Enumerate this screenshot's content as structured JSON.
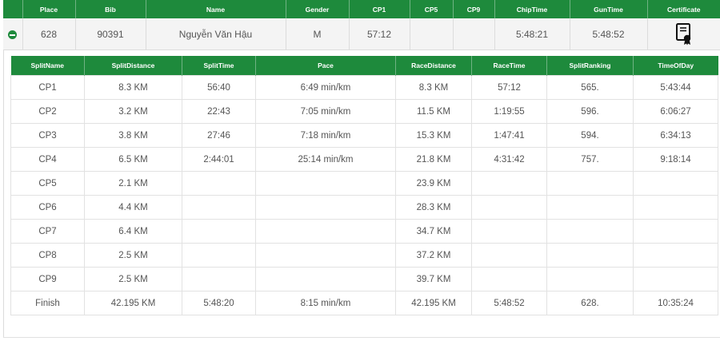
{
  "main": {
    "headers": [
      "Place",
      "Bib",
      "Name",
      "Gender",
      "CP1",
      "CP5",
      "CP9",
      "ChipTime",
      "GunTime",
      "Certificate"
    ],
    "row": {
      "place": "628",
      "bib": "90391",
      "name": "Nguyễn Văn Hậu",
      "gender": "M",
      "cp1": "57:12",
      "cp5": "",
      "cp9": "",
      "chip_time": "5:48:21",
      "gun_time": "5:48:52",
      "certificate_icon": "certificate-icon",
      "toggle_icon": "minus-circle-icon"
    }
  },
  "splits": {
    "headers": [
      "SplitName",
      "SplitDistance",
      "SplitTime",
      "Pace",
      "RaceDistance",
      "RaceTime",
      "SplitRanking",
      "TimeOfDay"
    ],
    "rows": [
      [
        "CP1",
        "8.3 KM",
        "56:40",
        "6:49 min/km",
        "8.3 KM",
        "57:12",
        "565.",
        "5:43:44"
      ],
      [
        "CP2",
        "3.2 KM",
        "22:43",
        "7:05 min/km",
        "11.5 KM",
        "1:19:55",
        "596.",
        "6:06:27"
      ],
      [
        "CP3",
        "3.8 KM",
        "27:46",
        "7:18 min/km",
        "15.3 KM",
        "1:47:41",
        "594.",
        "6:34:13"
      ],
      [
        "CP4",
        "6.5 KM",
        "2:44:01",
        "25:14 min/km",
        "21.8 KM",
        "4:31:42",
        "757.",
        "9:18:14"
      ],
      [
        "CP5",
        "2.1 KM",
        "",
        "",
        "23.9 KM",
        "",
        "",
        ""
      ],
      [
        "CP6",
        "4.4 KM",
        "",
        "",
        "28.3 KM",
        "",
        "",
        ""
      ],
      [
        "CP7",
        "6.4 KM",
        "",
        "",
        "34.7 KM",
        "",
        "",
        ""
      ],
      [
        "CP8",
        "2.5 KM",
        "",
        "",
        "37.2 KM",
        "",
        "",
        ""
      ],
      [
        "CP9",
        "2.5 KM",
        "",
        "",
        "39.7 KM",
        "",
        "",
        ""
      ],
      [
        "Finish",
        "42.195 KM",
        "5:48:20",
        "8:15 min/km",
        "42.195 KM",
        "5:48:52",
        "628.",
        "10:35:24"
      ]
    ]
  },
  "colors": {
    "header_green": "#1e8a3c",
    "row_bg": "#f4f4f4"
  }
}
